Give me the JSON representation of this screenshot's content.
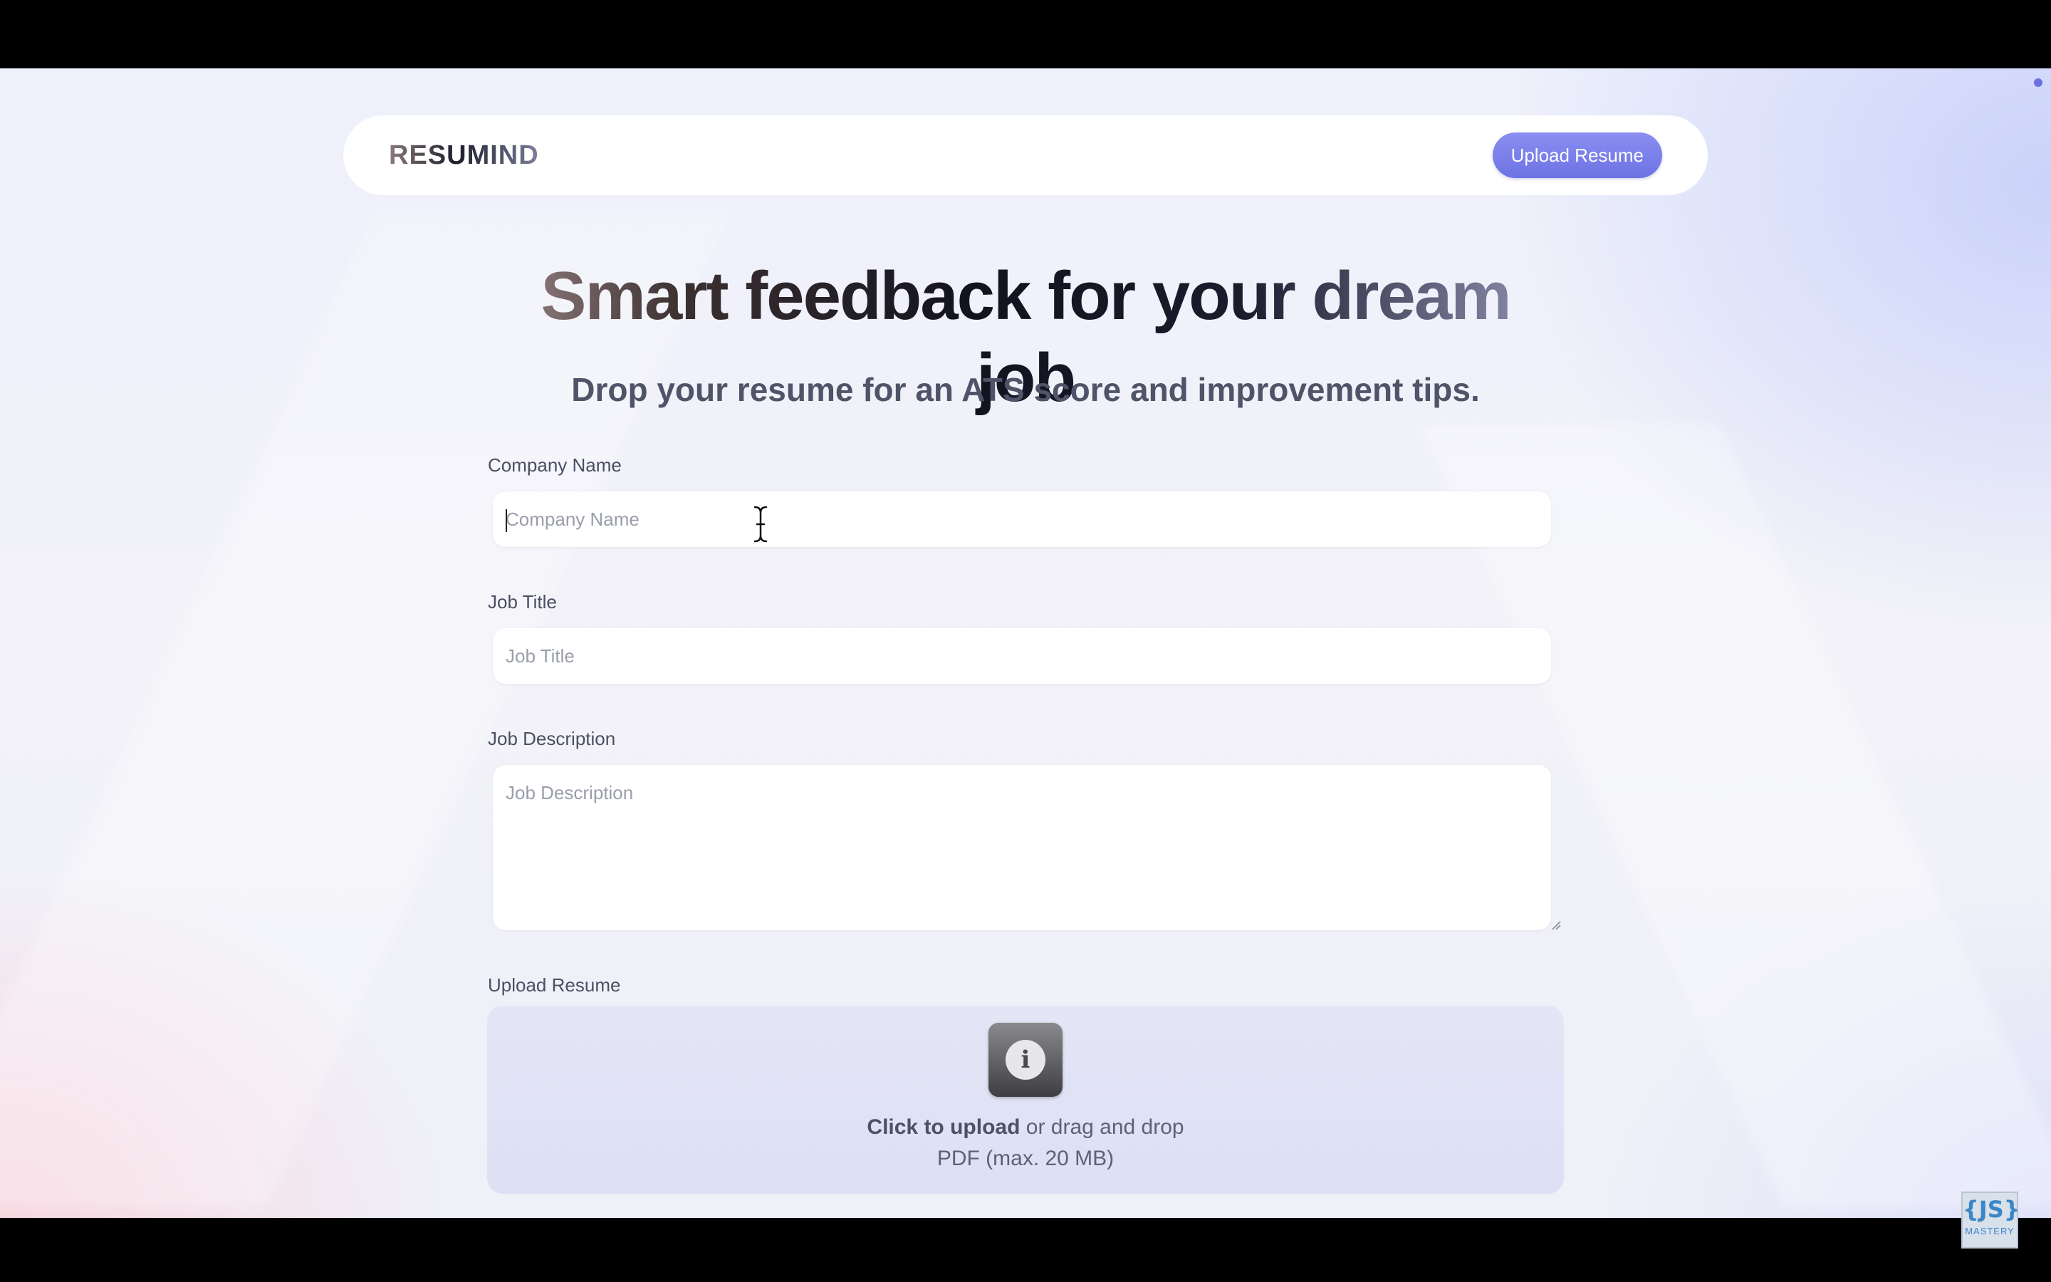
{
  "navbar": {
    "logo": "RESUMIND",
    "upload_button": "Upload Resume"
  },
  "hero": {
    "title": "Smart feedback for your dream job",
    "subtitle": "Drop your resume for an ATS score and improvement tips."
  },
  "form": {
    "company_name": {
      "label": "Company Name",
      "placeholder": "Company Name",
      "value": ""
    },
    "job_title": {
      "label": "Job Title",
      "placeholder": "Job Title",
      "value": ""
    },
    "job_description": {
      "label": "Job Description",
      "placeholder": "Job Description",
      "value": ""
    },
    "upload": {
      "label": "Upload Resume",
      "click_text": "Click to upload",
      "drag_text": " or drag and drop",
      "hint": "PDF (max. 20 MB)",
      "icon": "info-icon"
    }
  },
  "badge": {
    "mark": "{JS}",
    "text": "MASTERY"
  },
  "colors": {
    "accent": "#6d72e4",
    "background": "#eef0fb",
    "text_muted": "#4a4f63"
  }
}
